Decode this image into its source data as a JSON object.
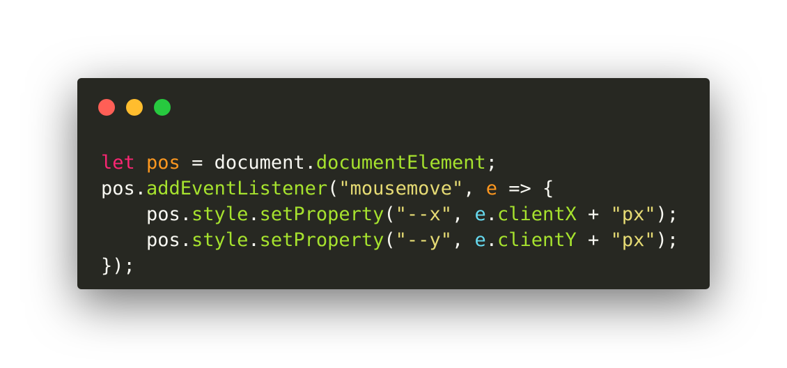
{
  "window": {
    "background": "#272822",
    "buttons": [
      {
        "name": "close",
        "color": "#ff5f56"
      },
      {
        "name": "minimize",
        "color": "#ffbd2e"
      },
      {
        "name": "maximize",
        "color": "#27c93f"
      }
    ]
  },
  "code": {
    "language": "javascript",
    "theme_colors": {
      "keyword": "#f92672",
      "variable": "#fd971f",
      "default": "#f8f8f2",
      "function": "#a6e22e",
      "string": "#e6db74",
      "param": "#66d9ef"
    },
    "lines": [
      [
        {
          "text": "let",
          "kind": "keyword"
        },
        {
          "text": " ",
          "kind": "default"
        },
        {
          "text": "pos",
          "kind": "variable"
        },
        {
          "text": " = document.",
          "kind": "default"
        },
        {
          "text": "documentElement",
          "kind": "function"
        },
        {
          "text": ";",
          "kind": "default"
        }
      ],
      [
        {
          "text": "pos.",
          "kind": "default"
        },
        {
          "text": "addEventListener",
          "kind": "function"
        },
        {
          "text": "(",
          "kind": "default"
        },
        {
          "text": "\"mousemove\"",
          "kind": "string"
        },
        {
          "text": ", ",
          "kind": "default"
        },
        {
          "text": "e",
          "kind": "variable"
        },
        {
          "text": " => {",
          "kind": "default"
        }
      ],
      [
        {
          "text": "    pos.",
          "kind": "default"
        },
        {
          "text": "style",
          "kind": "function"
        },
        {
          "text": ".",
          "kind": "default"
        },
        {
          "text": "setProperty",
          "kind": "function"
        },
        {
          "text": "(",
          "kind": "default"
        },
        {
          "text": "\"--x\"",
          "kind": "string"
        },
        {
          "text": ", ",
          "kind": "default"
        },
        {
          "text": "e",
          "kind": "param"
        },
        {
          "text": ".",
          "kind": "default"
        },
        {
          "text": "clientX",
          "kind": "function"
        },
        {
          "text": " + ",
          "kind": "default"
        },
        {
          "text": "\"px\"",
          "kind": "string"
        },
        {
          "text": ");",
          "kind": "default"
        }
      ],
      [
        {
          "text": "    pos.",
          "kind": "default"
        },
        {
          "text": "style",
          "kind": "function"
        },
        {
          "text": ".",
          "kind": "default"
        },
        {
          "text": "setProperty",
          "kind": "function"
        },
        {
          "text": "(",
          "kind": "default"
        },
        {
          "text": "\"--y\"",
          "kind": "string"
        },
        {
          "text": ", ",
          "kind": "default"
        },
        {
          "text": "e",
          "kind": "param"
        },
        {
          "text": ".",
          "kind": "default"
        },
        {
          "text": "clientY",
          "kind": "function"
        },
        {
          "text": " + ",
          "kind": "default"
        },
        {
          "text": "\"px\"",
          "kind": "string"
        },
        {
          "text": ");",
          "kind": "default"
        }
      ],
      [
        {
          "text": "});",
          "kind": "default"
        }
      ]
    ]
  }
}
